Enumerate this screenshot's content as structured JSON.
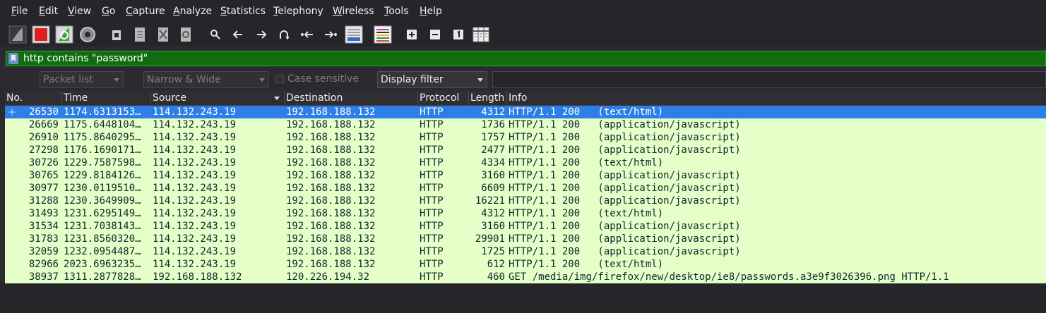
{
  "menu": [
    "File",
    "Edit",
    "View",
    "Go",
    "Capture",
    "Analyze",
    "Statistics",
    "Telephony",
    "Wireless",
    "Tools",
    "Help"
  ],
  "toolbar_icons": [
    "start-capture-icon",
    "stop-capture-icon",
    "restart-capture-icon",
    "capture-options-icon",
    "open-file-icon",
    "save-file-icon",
    "close-file-icon",
    "reload-file-icon",
    "find-packet-icon",
    "go-back-icon",
    "go-forward-icon",
    "go-to-packet-icon",
    "go-first-packet-icon",
    "go-last-packet-icon",
    "autoscroll-icon",
    "colorize-icon",
    "zoom-in-icon",
    "zoom-out-icon",
    "normal-size-icon",
    "resize-columns-icon"
  ],
  "filter": {
    "value": "http contains \"password\""
  },
  "search": {
    "packet_list_label": "Packet list",
    "narrow_wide_label": "Narrow & Wide",
    "case_sensitive_label": "Case sensitive",
    "display_filter_label": "Display filter"
  },
  "columns": [
    "No.",
    "Time",
    "Source",
    "Destination",
    "Protocol",
    "Length",
    "Info"
  ],
  "packets": [
    {
      "no": "26530",
      "time": "1174.6313153…",
      "src": "114.132.243.19",
      "dst": "192.168.188.132",
      "proto": "HTTP",
      "len": "4312",
      "info": "HTTP/1.1 200   (text/html)"
    },
    {
      "no": "26669",
      "time": "1175.6448104…",
      "src": "114.132.243.19",
      "dst": "192.168.188.132",
      "proto": "HTTP",
      "len": "1736",
      "info": "HTTP/1.1 200   (application/javascript)"
    },
    {
      "no": "26910",
      "time": "1175.8640295…",
      "src": "114.132.243.19",
      "dst": "192.168.188.132",
      "proto": "HTTP",
      "len": "1757",
      "info": "HTTP/1.1 200   (application/javascript)"
    },
    {
      "no": "27298",
      "time": "1176.1690171…",
      "src": "114.132.243.19",
      "dst": "192.168.188.132",
      "proto": "HTTP",
      "len": "2477",
      "info": "HTTP/1.1 200   (application/javascript)"
    },
    {
      "no": "30726",
      "time": "1229.7587598…",
      "src": "114.132.243.19",
      "dst": "192.168.188.132",
      "proto": "HTTP",
      "len": "4334",
      "info": "HTTP/1.1 200   (text/html)"
    },
    {
      "no": "30765",
      "time": "1229.8184126…",
      "src": "114.132.243.19",
      "dst": "192.168.188.132",
      "proto": "HTTP",
      "len": "3160",
      "info": "HTTP/1.1 200   (application/javascript)"
    },
    {
      "no": "30977",
      "time": "1230.0119510…",
      "src": "114.132.243.19",
      "dst": "192.168.188.132",
      "proto": "HTTP",
      "len": "6609",
      "info": "HTTP/1.1 200   (application/javascript)"
    },
    {
      "no": "31288",
      "time": "1230.3649909…",
      "src": "114.132.243.19",
      "dst": "192.168.188.132",
      "proto": "HTTP",
      "len": "16221",
      "info": "HTTP/1.1 200   (application/javascript)"
    },
    {
      "no": "31493",
      "time": "1231.6295149…",
      "src": "114.132.243.19",
      "dst": "192.168.188.132",
      "proto": "HTTP",
      "len": "4312",
      "info": "HTTP/1.1 200   (text/html)"
    },
    {
      "no": "31534",
      "time": "1231.7038143…",
      "src": "114.132.243.19",
      "dst": "192.168.188.132",
      "proto": "HTTP",
      "len": "3160",
      "info": "HTTP/1.1 200   (application/javascript)"
    },
    {
      "no": "31783",
      "time": "1231.8560320…",
      "src": "114.132.243.19",
      "dst": "192.168.188.132",
      "proto": "HTTP",
      "len": "29901",
      "info": "HTTP/1.1 200   (application/javascript)"
    },
    {
      "no": "32059",
      "time": "1232.0954487…",
      "src": "114.132.243.19",
      "dst": "192.168.188.132",
      "proto": "HTTP",
      "len": "1725",
      "info": "HTTP/1.1 200   (application/javascript)"
    },
    {
      "no": "82966",
      "time": "2023.6963235…",
      "src": "114.132.243.19",
      "dst": "192.168.188.132",
      "proto": "HTTP",
      "len": "612",
      "info": "HTTP/1.1 200   (text/html)"
    },
    {
      "no": "38937",
      "time": "1311.2877828…",
      "src": "192.168.188.132",
      "dst": "120.226.194.32",
      "proto": "HTTP",
      "len": "460",
      "info": "GET /media/img/firefox/new/desktop/ie8/passwords.a3e9f3026396.png HTTP/1.1"
    }
  ],
  "colors": {
    "row_bg": "#e4ffc7",
    "selected_row_bg": "#2d7ee6",
    "filter_bg": "#0f6d0f"
  }
}
